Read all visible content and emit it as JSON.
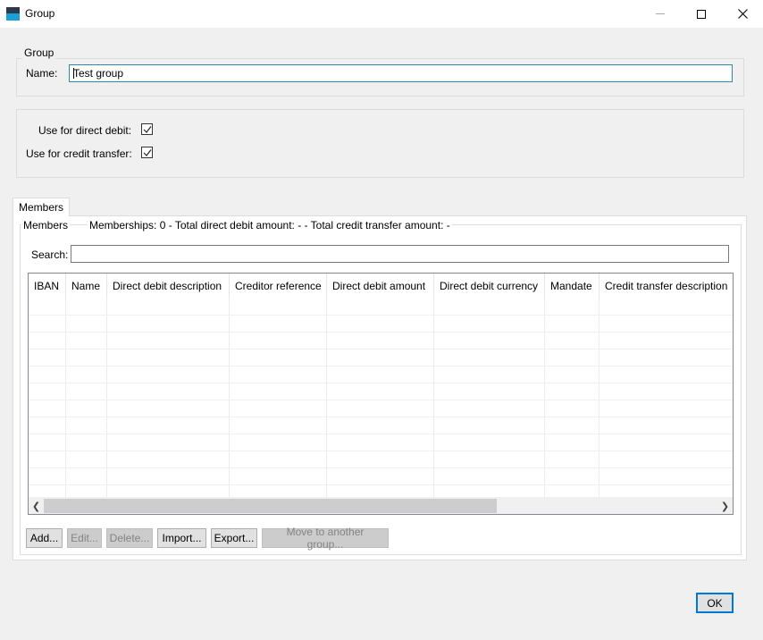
{
  "window": {
    "title": "Group"
  },
  "group_box": {
    "label": "Group",
    "name_label": "Name:",
    "name_value": "Test group"
  },
  "options": {
    "direct_debit_label": "Use for direct debit:",
    "direct_debit_checked": true,
    "credit_transfer_label": "Use for credit transfer:",
    "credit_transfer_checked": true
  },
  "tabs": [
    {
      "label": "Members"
    }
  ],
  "members": {
    "group_label": "Members",
    "summary": "Memberships: 0 - Total direct debit amount: - - Total credit transfer amount: -",
    "search_label": "Search:",
    "search_value": "",
    "columns": [
      "IBAN",
      "Name",
      "Direct debit description",
      "Creditor reference",
      "Direct debit amount",
      "Direct debit currency",
      "Mandate",
      "Credit transfer description"
    ],
    "rows": []
  },
  "buttons": {
    "add": "Add...",
    "edit": "Edit...",
    "delete": "Delete...",
    "import": "Import...",
    "export": "Export...",
    "move": "Move to another group...",
    "ok": "OK"
  }
}
